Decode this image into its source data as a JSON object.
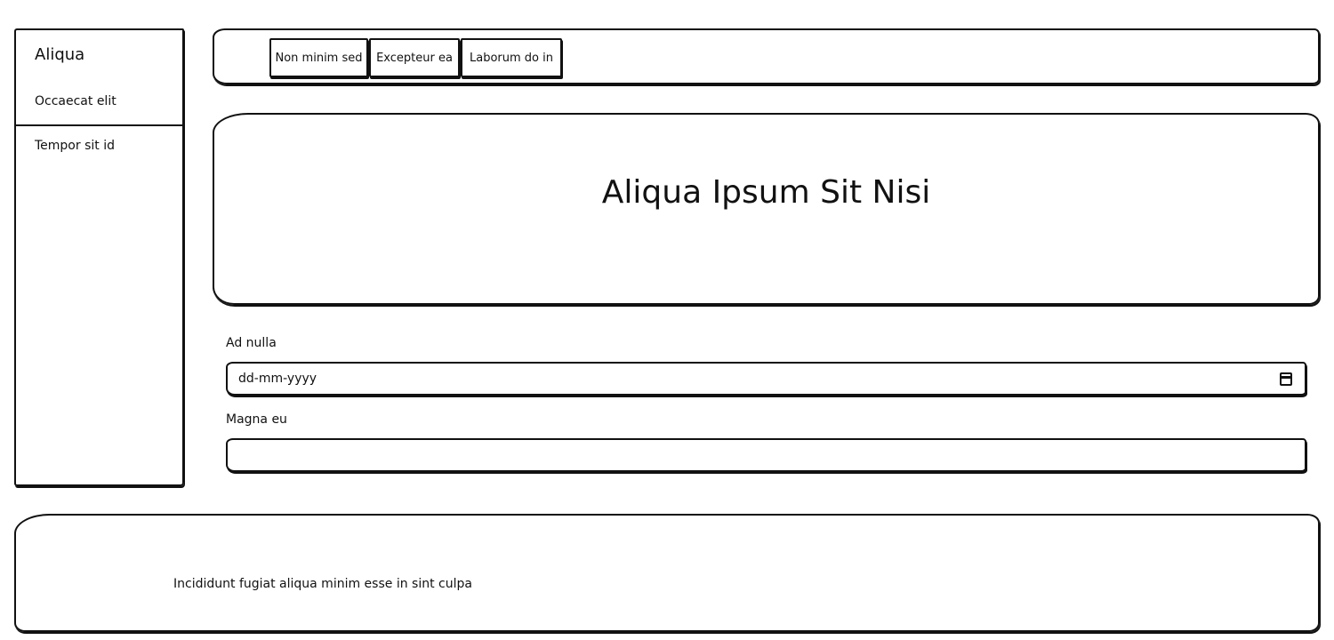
{
  "sidebar": {
    "title": "Aliqua",
    "items": [
      {
        "label": "Occaecat elit"
      },
      {
        "label": "Tempor sit id"
      }
    ]
  },
  "nav": {
    "tabs": [
      {
        "label": "Non minim sed"
      },
      {
        "label": "Excepteur ea"
      },
      {
        "label": "Laborum do in"
      }
    ]
  },
  "hero": {
    "title": "Aliqua Ipsum Sit Nisi"
  },
  "form": {
    "date_field": {
      "label": "Ad nulla",
      "placeholder": "dd-mm-yyyy",
      "value": ""
    },
    "text_field": {
      "label": "Magna eu",
      "placeholder": "",
      "value": ""
    }
  },
  "footer": {
    "text": "Incididunt fugiat aliqua minim esse in sint culpa"
  },
  "icons": {
    "date_picker": "calendar-icon"
  },
  "colors": {
    "border": "#111111",
    "background": "#ffffff",
    "text": "#111111"
  }
}
